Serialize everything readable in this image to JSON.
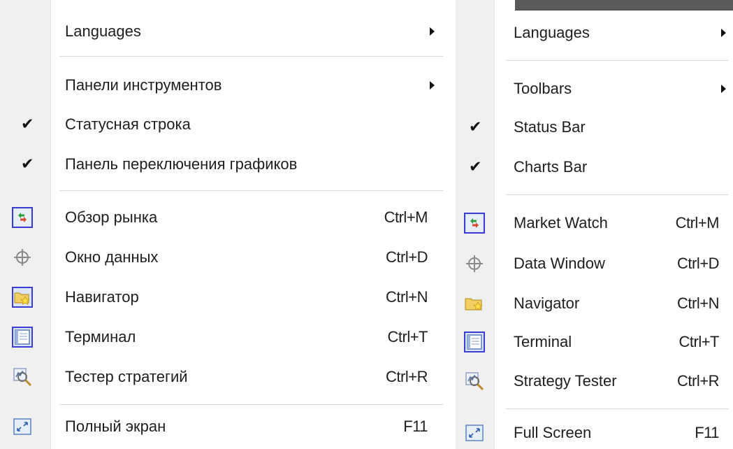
{
  "menus": [
    {
      "language": "ru",
      "items": {
        "languages": {
          "label": "Languages"
        },
        "toolbars": {
          "label": "Панели инструментов"
        },
        "status_bar": {
          "label": "Статусная строка"
        },
        "charts_bar": {
          "label": "Панель переключения графиков"
        },
        "market_watch": {
          "label": "Обзор рынка",
          "shortcut": "Ctrl+M"
        },
        "data_window": {
          "label": "Окно данных",
          "shortcut": "Ctrl+D"
        },
        "navigator": {
          "label": "Навигатор",
          "shortcut": "Ctrl+N"
        },
        "terminal": {
          "label": "Терминал",
          "shortcut": "Ctrl+T"
        },
        "strategy_tester": {
          "label": "Тестер стратегий",
          "shortcut": "Ctrl+R"
        },
        "full_screen": {
          "label": "Полный экран",
          "shortcut": "F11"
        }
      }
    },
    {
      "language": "en",
      "items": {
        "languages": {
          "label": "Languages"
        },
        "toolbars": {
          "label": "Toolbars"
        },
        "status_bar": {
          "label": "Status Bar"
        },
        "charts_bar": {
          "label": "Charts Bar"
        },
        "market_watch": {
          "label": "Market Watch",
          "shortcut": "Ctrl+M"
        },
        "data_window": {
          "label": "Data Window",
          "shortcut": "Ctrl+D"
        },
        "navigator": {
          "label": "Navigator",
          "shortcut": "Ctrl+N"
        },
        "terminal": {
          "label": "Terminal",
          "shortcut": "Ctrl+T"
        },
        "strategy_tester": {
          "label": "Strategy Tester",
          "shortcut": "Ctrl+R"
        },
        "full_screen": {
          "label": "Full Screen",
          "shortcut": "F11"
        }
      }
    }
  ],
  "glyphs": {
    "check": "✔"
  },
  "icons": {
    "market_watch": "market-watch-icon",
    "data_window": "crosshair-icon",
    "navigator": "folder-star-icon",
    "terminal": "terminal-icon",
    "strategy_tester": "strategy-tester-icon",
    "full_screen": "fullscreen-icon"
  },
  "colors": {
    "gutter": "#f0f0f0",
    "icon_frame": "#3b3bd6",
    "separator": "#d8d8d8",
    "text": "#1e1e1e"
  }
}
